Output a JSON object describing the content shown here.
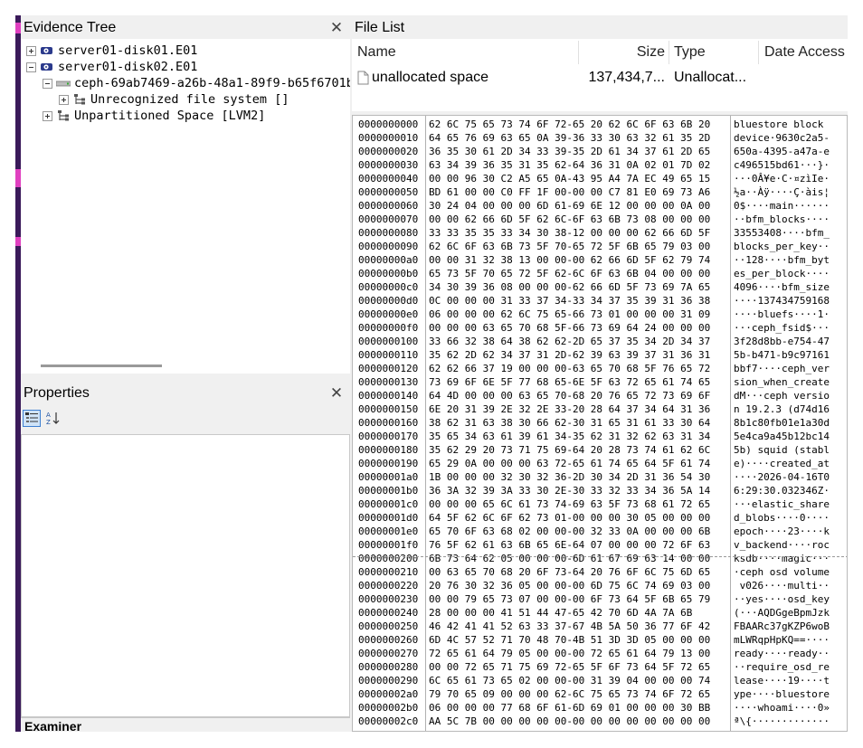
{
  "left": {
    "evidence_tree_title": "Evidence Tree",
    "tree_nodes": [
      {
        "label": "server01-disk01.E01",
        "icon": "evidence-disk-icon",
        "expander": "plus"
      },
      {
        "label": "server01-disk02.E01",
        "icon": "evidence-disk-icon",
        "expander": "minus"
      },
      {
        "label": "ceph-69ab7469-a26b-48a1-89f9-b65f6701b",
        "icon": "volume-icon",
        "expander": "minus"
      },
      {
        "label": "Unrecognized file system []",
        "icon": "filesystem-icon",
        "expander": "plus"
      },
      {
        "label": "Unpartitioned Space [LVM2]",
        "icon": "filesystem-icon",
        "expander": "plus"
      }
    ],
    "properties_title": "Properties",
    "examiner_title": "Examiner"
  },
  "right": {
    "file_list_title": "File List",
    "columns": {
      "name": "Name",
      "size": "Size",
      "type": "Type",
      "date": "Date Access"
    },
    "row": {
      "name": "unallocated space",
      "size": "137,434,7...",
      "type": "Unallocat..."
    },
    "hex_rows": [
      {
        "o": "0000000000",
        "h": "62 6C 75 65 73 74 6F 72-65 20 62 6C 6F 63 6B 20",
        "a": "bluestore block "
      },
      {
        "o": "0000000010",
        "h": "64 65 76 69 63 65 0A 39-36 33 30 63 32 61 35 2D",
        "a": "device·9630c2a5-"
      },
      {
        "o": "0000000020",
        "h": "36 35 30 61 2D 34 33 39-35 2D 61 34 37 61 2D 65",
        "a": "650a-4395-a47a-e"
      },
      {
        "o": "0000000030",
        "h": "63 34 39 36 35 31 35 62-64 36 31 0A 02 01 7D 02",
        "a": "c496515bd61···}·"
      },
      {
        "o": "0000000040",
        "h": "00 00 96 30 C2 A5 65 0A-43 95 A4 7A EC 49 65 15",
        "a": "···0Â¥e·C·¤zìIe·"
      },
      {
        "o": "0000000050",
        "h": "BD 61 00 00 C0 FF 1F 00-00 00 C7 81 E0 69 73 A6",
        "a": "½a··Àÿ····Ç·àis¦"
      },
      {
        "o": "0000000060",
        "h": "30 24 04 00 00 00 6D 61-69 6E 12 00 00 00 0A 00",
        "a": "0$····main······"
      },
      {
        "o": "0000000070",
        "h": "00 00 62 66 6D 5F 62 6C-6F 63 6B 73 08 00 00 00",
        "a": "··bfm_blocks····"
      },
      {
        "o": "0000000080",
        "h": "33 33 35 35 33 34 30 38-12 00 00 00 62 66 6D 5F",
        "a": "33553408····bfm_"
      },
      {
        "o": "0000000090",
        "h": "62 6C 6F 63 6B 73 5F 70-65 72 5F 6B 65 79 03 00",
        "a": "blocks_per_key··"
      },
      {
        "o": "00000000a0",
        "h": "00 00 31 32 38 13 00 00-00 62 66 6D 5F 62 79 74",
        "a": "··128····bfm_byt"
      },
      {
        "o": "00000000b0",
        "h": "65 73 5F 70 65 72 5F 62-6C 6F 63 6B 04 00 00 00",
        "a": "es_per_block····"
      },
      {
        "o": "00000000c0",
        "h": "34 30 39 36 08 00 00 00-62 66 6D 5F 73 69 7A 65",
        "a": "4096····bfm_size"
      },
      {
        "o": "00000000d0",
        "h": "0C 00 00 00 31 33 37 34-33 34 37 35 39 31 36 38",
        "a": "····137434759168"
      },
      {
        "o": "00000000e0",
        "h": "06 00 00 00 62 6C 75 65-66 73 01 00 00 00 31 09",
        "a": "····bluefs····1·"
      },
      {
        "o": "00000000f0",
        "h": "00 00 00 63 65 70 68 5F-66 73 69 64 24 00 00 00",
        "a": "···ceph_fsid$···"
      },
      {
        "o": "0000000100",
        "h": "33 66 32 38 64 38 62 62-2D 65 37 35 34 2D 34 37",
        "a": "3f28d8bb-e754-47"
      },
      {
        "o": "0000000110",
        "h": "35 62 2D 62 34 37 31 2D-62 39 63 39 37 31 36 31",
        "a": "5b-b471-b9c97161"
      },
      {
        "o": "0000000120",
        "h": "62 62 66 37 19 00 00 00-63 65 70 68 5F 76 65 72",
        "a": "bbf7····ceph_ver"
      },
      {
        "o": "0000000130",
        "h": "73 69 6F 6E 5F 77 68 65-6E 5F 63 72 65 61 74 65",
        "a": "sion_when_create"
      },
      {
        "o": "0000000140",
        "h": "64 4D 00 00 00 63 65 70-68 20 76 65 72 73 69 6F",
        "a": "dM···ceph versio"
      },
      {
        "o": "0000000150",
        "h": "6E 20 31 39 2E 32 2E 33-20 28 64 37 34 64 31 36",
        "a": "n 19.2.3 (d74d16"
      },
      {
        "o": "0000000160",
        "h": "38 62 31 63 38 30 66 62-30 31 65 31 61 33 30 64",
        "a": "8b1c80fb01e1a30d"
      },
      {
        "o": "0000000170",
        "h": "35 65 34 63 61 39 61 34-35 62 31 32 62 63 31 34",
        "a": "5e4ca9a45b12bc14"
      },
      {
        "o": "0000000180",
        "h": "35 62 29 20 73 71 75 69-64 20 28 73 74 61 62 6C",
        "a": "5b) squid (stabl"
      },
      {
        "o": "0000000190",
        "h": "65 29 0A 00 00 00 63 72-65 61 74 65 64 5F 61 74",
        "a": "e)····created_at"
      },
      {
        "o": "00000001a0",
        "h": "1B 00 00 00 32 30 32 36-2D 30 34 2D 31 36 54 30",
        "a": "····2026-04-16T0"
      },
      {
        "o": "00000001b0",
        "h": "36 3A 32 39 3A 33 30 2E-30 33 32 33 34 36 5A 14",
        "a": "6:29:30.032346Z·"
      },
      {
        "o": "00000001c0",
        "h": "00 00 00 65 6C 61 73 74-69 63 5F 73 68 61 72 65",
        "a": "···elastic_share"
      },
      {
        "o": "00000001d0",
        "h": "64 5F 62 6C 6F 62 73 01-00 00 00 30 05 00 00 00",
        "a": "d_blobs····0····"
      },
      {
        "o": "00000001e0",
        "h": "65 70 6F 63 68 02 00 00-00 32 33 0A 00 00 00 6B",
        "a": "epoch····23····k"
      },
      {
        "o": "00000001f0",
        "h": "76 5F 62 61 63 6B 65 6E-64 07 00 00 00 72 6F 63",
        "a": "v_backend····roc"
      },
      {
        "o": "0000000200",
        "h": "6B 73 64 62 05 00 00 00-6D 61 67 69 63 14 00 00",
        "a": "ksdb····magic···"
      },
      {
        "o": "0000000210",
        "h": "00 63 65 70 68 20 6F 73-64 20 76 6F 6C 75 6D 65",
        "a": "·ceph osd volume"
      },
      {
        "o": "0000000220",
        "h": "20 76 30 32 36 05 00 00-00 6D 75 6C 74 69 03 00",
        "a": " v026····multi··"
      },
      {
        "o": "0000000230",
        "h": "00 00 79 65 73 07 00 00-00 6F 73 64 5F 6B 65 79",
        "a": "··yes····osd_key"
      },
      {
        "o": "0000000240",
        "h": "28 00 00 00 41 51 44 47-65 42 70 6D 4A 7A 6B",
        "a": "(···AQDGgeBpmJzk"
      },
      {
        "o": "0000000250",
        "h": "46 42 41 41 52 63 33 37-67 4B 5A 50 36 77 6F 42",
        "a": "FBAARc37gKZP6woB"
      },
      {
        "o": "0000000260",
        "h": "6D 4C 57 52 71 70 48 70-4B 51 3D 3D 05 00 00 00",
        "a": "mLWRqpHpKQ==····"
      },
      {
        "o": "0000000270",
        "h": "72 65 61 64 79 05 00 00-00 72 65 61 64 79 13 00",
        "a": "ready····ready··"
      },
      {
        "o": "0000000280",
        "h": "00 00 72 65 71 75 69 72-65 5F 6F 73 64 5F 72 65",
        "a": "··require_osd_re"
      },
      {
        "o": "0000000290",
        "h": "6C 65 61 73 65 02 00 00-00 31 39 04 00 00 00 74",
        "a": "lease····19····t"
      },
      {
        "o": "00000002a0",
        "h": "79 70 65 09 00 00 00 62-6C 75 65 73 74 6F 72 65",
        "a": "ype····bluestore"
      },
      {
        "o": "00000002b0",
        "h": "06 00 00 00 77 68 6F 61-6D 69 01 00 00 00 30 BB",
        "a": "····whoami····0»"
      },
      {
        "o": "00000002c0",
        "h": "AA 5C 7B 00 00 00 00 00-00 00 00 00 00 00 00 00",
        "a": "ª\\{·············"
      }
    ]
  }
}
